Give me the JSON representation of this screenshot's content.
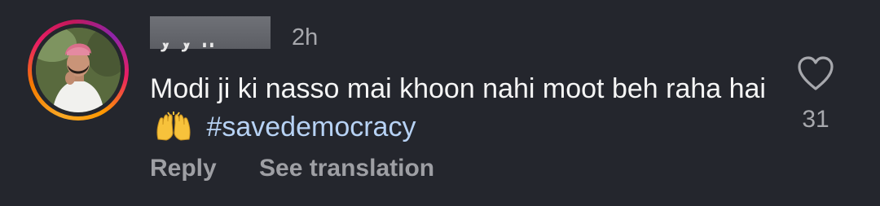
{
  "comment": {
    "username_visible_fragment": "y y n",
    "timestamp": "2h",
    "text_main": "Modi ji ki nasso mai khoon nahi moot beh raha hai",
    "emoji": "🙌",
    "hashtag": "#savedemocracy",
    "like_count": "31",
    "reply_label": "Reply",
    "translate_label": "See translation"
  },
  "icons": {
    "like": "heart-outline-icon",
    "emoji": "raising-hands-emoji"
  },
  "colors": {
    "background": "#24262d",
    "text": "#f5f5f5",
    "muted": "#a7a8ad",
    "hashtag": "#b7d2f4"
  }
}
